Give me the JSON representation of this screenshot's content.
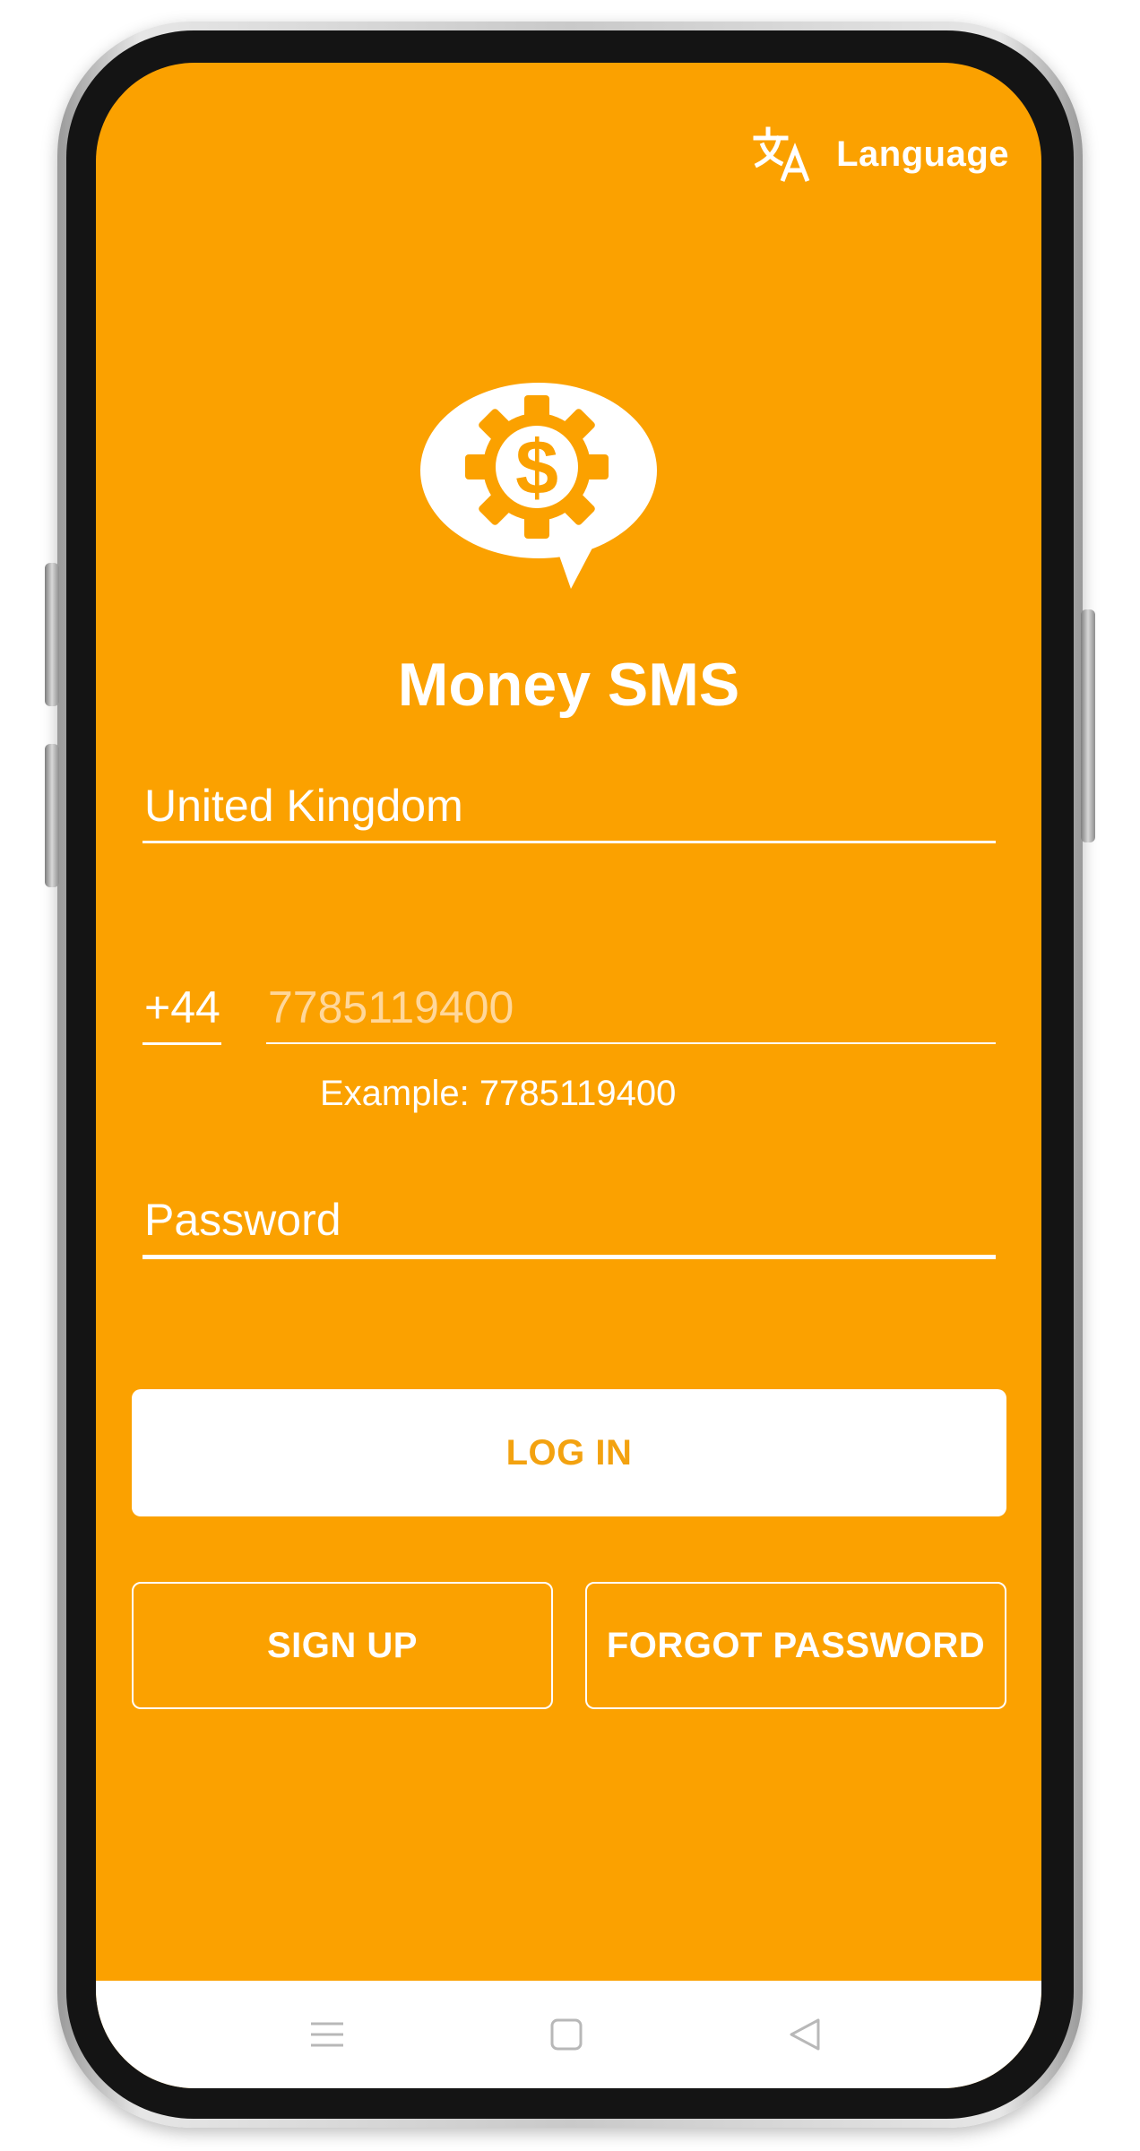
{
  "language": {
    "label": "Language",
    "icon": "translate-icon"
  },
  "app": {
    "logo_icon": "money-sms-logo-icon",
    "title": "Money SMS"
  },
  "form": {
    "country_value": "United Kingdom",
    "dial_code": "+44",
    "phone_placeholder": "7785119400",
    "phone_hint": "Example: 7785119400",
    "password_placeholder": "Password"
  },
  "buttons": {
    "login": "LOG IN",
    "signup": "SIGN UP",
    "forgot_password": "FORGOT PASSWORD"
  },
  "nav": {
    "menu_icon": "recent-apps-icon",
    "home_icon": "home-icon",
    "back_icon": "back-icon"
  },
  "colors": {
    "accent": "#fba100",
    "button_text": "#f3a210",
    "background": "#ffffff"
  }
}
